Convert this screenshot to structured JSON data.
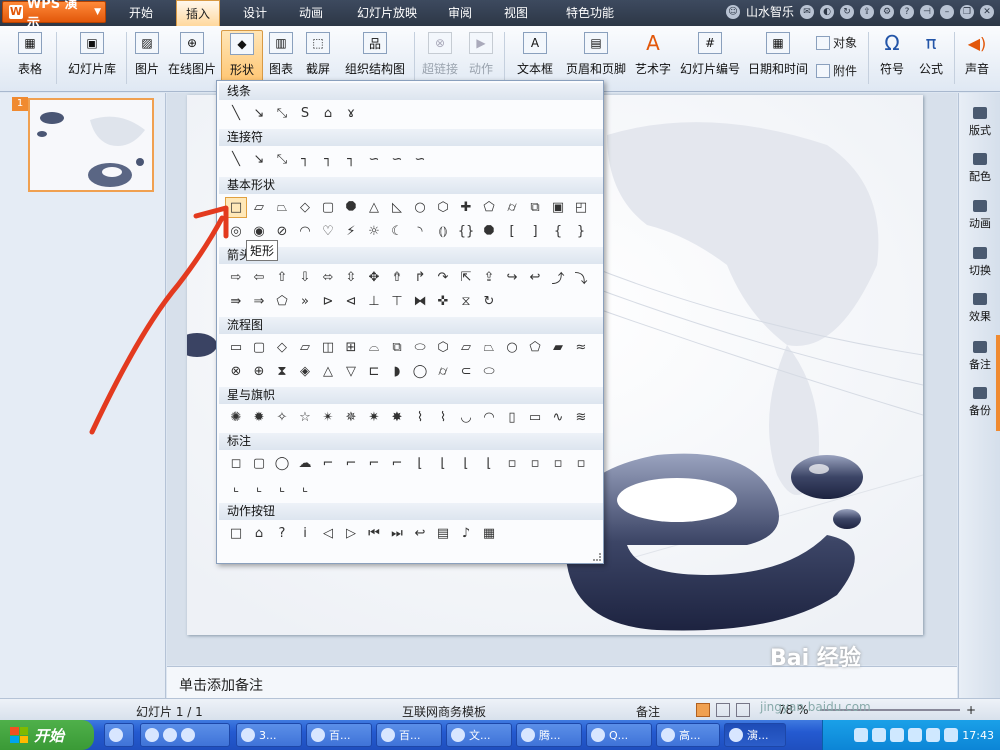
{
  "app": {
    "button_label": "WPS 演示",
    "menus": [
      "开始",
      "插入",
      "设计",
      "动画",
      "幻灯片放映",
      "审阅",
      "视图",
      "特色功能"
    ],
    "active_menu": "插入",
    "user_name": "山水智乐"
  },
  "ribbon": {
    "table": "表格",
    "slide_library": "幻灯片库",
    "picture": "图片",
    "online_picture": "在线图片",
    "shapes": "形状",
    "chart": "图表",
    "screenshot": "截屏",
    "org_chart": "组织结构图",
    "hyperlink": "超链接",
    "action": "动作",
    "textbox": "文本框",
    "header_footer": "页眉和页脚",
    "wordart": "艺术字",
    "slide_number": "幻灯片编号",
    "date_time": "日期和时间",
    "object": "对象",
    "attachment": "附件",
    "symbol": "符号",
    "formula": "公式",
    "sound": "声音"
  },
  "shapes_menu": {
    "sections": [
      "线条",
      "连接符",
      "基本形状",
      "箭头总汇",
      "流程图",
      "星与旗帜",
      "标注",
      "动作按钮"
    ],
    "tooltip": "矩形"
  },
  "slides_pane": {
    "slide_number": "1"
  },
  "right_pane": [
    "版式",
    "配色",
    "动画",
    "切换",
    "效果",
    "备注",
    "备份"
  ],
  "notes": {
    "placeholder": "单击添加备注"
  },
  "status": {
    "slide_info": "幻灯片 1 / 1",
    "template": "互联网商务模板",
    "notes_toggle": "备注",
    "zoom": "78 %"
  },
  "taskbar": {
    "start": "开始",
    "items": [
      "3...",
      "百...",
      "百...",
      "文...",
      "腾...",
      "Q...",
      "高...",
      "演..."
    ],
    "clock": "17:43"
  },
  "watermark": {
    "brand": "Bai 经验",
    "url": "jingyan.baidu.com"
  }
}
